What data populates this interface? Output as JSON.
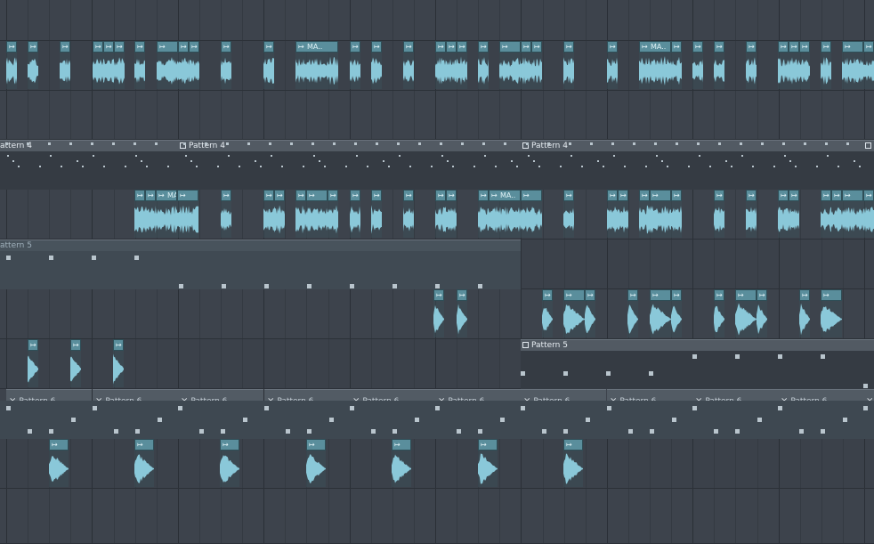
{
  "playlist": {
    "lanes": 11,
    "colors": {
      "clip_header": "#5a8e9c",
      "waveform": "#8ed0e0",
      "pattern_header": "#525a63",
      "grid_line": "#2a2f36"
    },
    "audio_clip_label": "MA..",
    "pattern4_label": "Pattern 4",
    "pattern4_left_label": "attern 4",
    "pattern5_label": "Pattern 5",
    "pattern5_left_label": "attern 5",
    "pattern6_label": "Pattern 6"
  }
}
